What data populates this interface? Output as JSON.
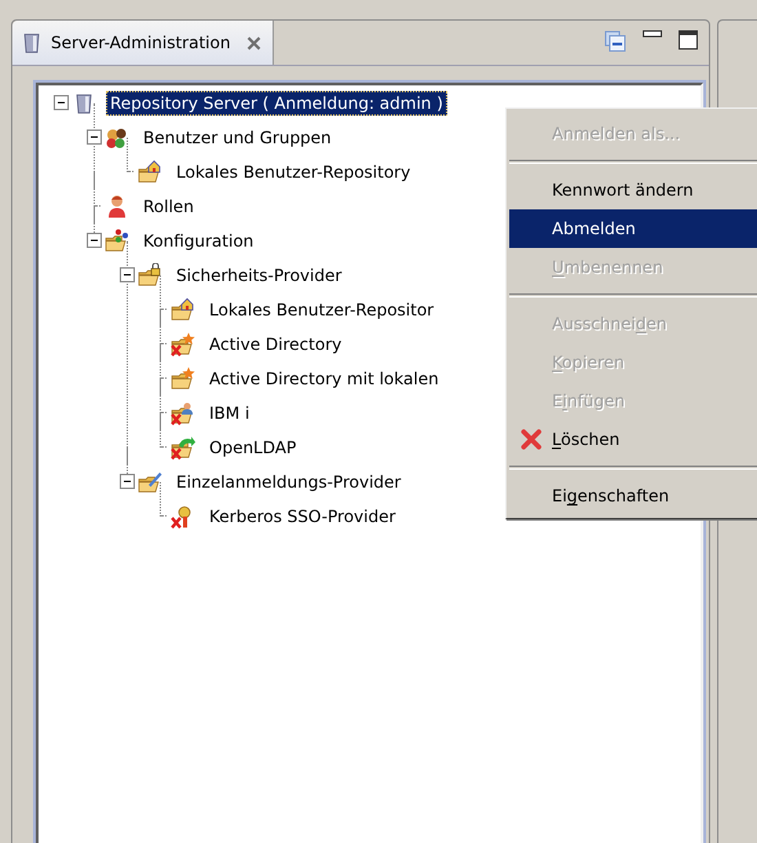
{
  "tab": {
    "title": "Server-Administration",
    "selected": true
  },
  "tree": [
    {
      "label": "Repository Server ( Anmeldung: admin )",
      "kind": "server",
      "selected": true,
      "error": false,
      "expanded": true,
      "children": [
        {
          "label": "Benutzer und Gruppen",
          "kind": "users",
          "selected": false,
          "error": false,
          "expanded": true,
          "children": [
            {
              "label": "Lokales Benutzer-Repository",
              "kind": "folder-house",
              "selected": false,
              "error": false
            }
          ]
        },
        {
          "label": "Rollen",
          "kind": "person",
          "selected": false,
          "error": false
        },
        {
          "label": "Konfiguration",
          "kind": "folder-network",
          "selected": false,
          "error": false,
          "expanded": true,
          "children": [
            {
              "label": "Sicherheits-Provider",
              "kind": "folder-lock",
              "selected": false,
              "error": false,
              "expanded": true,
              "children": [
                {
                  "label": "Lokales Benutzer-Repositor",
                  "kind": "folder-house",
                  "selected": false,
                  "error": false
                },
                {
                  "label": "Active Directory",
                  "kind": "folder-star",
                  "selected": false,
                  "error": true
                },
                {
                  "label": "Active Directory mit lokalen",
                  "kind": "folder-star",
                  "selected": false,
                  "error": false
                },
                {
                  "label": "IBM i",
                  "kind": "folder-person",
                  "selected": false,
                  "error": true
                },
                {
                  "label": "OpenLDAP",
                  "kind": "folder-arrow",
                  "selected": false,
                  "error": true
                }
              ]
            },
            {
              "label": "Einzelanmeldungs-Provider",
              "kind": "folder-pen",
              "selected": false,
              "error": false,
              "expanded": true,
              "children": [
                {
                  "label": "Kerberos SSO-Provider",
                  "kind": "key",
                  "selected": false,
                  "error": true
                }
              ]
            }
          ]
        }
      ]
    }
  ],
  "context_menu": {
    "items": [
      {
        "kind": "item",
        "segments": [
          {
            "text": "Anmelden als...",
            "underline": false
          }
        ],
        "disabled": true,
        "selected": false
      },
      {
        "kind": "separator"
      },
      {
        "kind": "item",
        "segments": [
          {
            "text": "Kennwort ändern",
            "underline": false
          }
        ],
        "disabled": false,
        "selected": false
      },
      {
        "kind": "item",
        "segments": [
          {
            "text": "Abmelden",
            "underline": false
          }
        ],
        "disabled": false,
        "selected": true
      },
      {
        "kind": "item",
        "segments": [
          {
            "text": "U",
            "underline": true
          },
          {
            "text": "mbenennen",
            "underline": false
          }
        ],
        "disabled": true,
        "selected": false
      },
      {
        "kind": "separator"
      },
      {
        "kind": "item",
        "segments": [
          {
            "text": "Ausschnei",
            "underline": false
          },
          {
            "text": "d",
            "underline": true
          },
          {
            "text": "en",
            "underline": false
          }
        ],
        "disabled": true,
        "selected": false
      },
      {
        "kind": "item",
        "segments": [
          {
            "text": "K",
            "underline": true
          },
          {
            "text": "opieren",
            "underline": false
          }
        ],
        "disabled": true,
        "selected": false
      },
      {
        "kind": "item",
        "segments": [
          {
            "text": "E",
            "underline": false
          },
          {
            "text": "i",
            "underline": true
          },
          {
            "text": "nfügen",
            "underline": false
          }
        ],
        "disabled": true,
        "selected": false
      },
      {
        "kind": "delete-item",
        "segments": [
          {
            "text": "L",
            "underline": true
          },
          {
            "text": "öschen",
            "underline": false
          }
        ],
        "disabled": false,
        "selected": false
      },
      {
        "kind": "separator"
      },
      {
        "kind": "item",
        "segments": [
          {
            "text": "Ei",
            "underline": false
          },
          {
            "text": "g",
            "underline": true
          },
          {
            "text": "enschaften",
            "underline": false
          }
        ],
        "disabled": false,
        "selected": false
      }
    ]
  }
}
